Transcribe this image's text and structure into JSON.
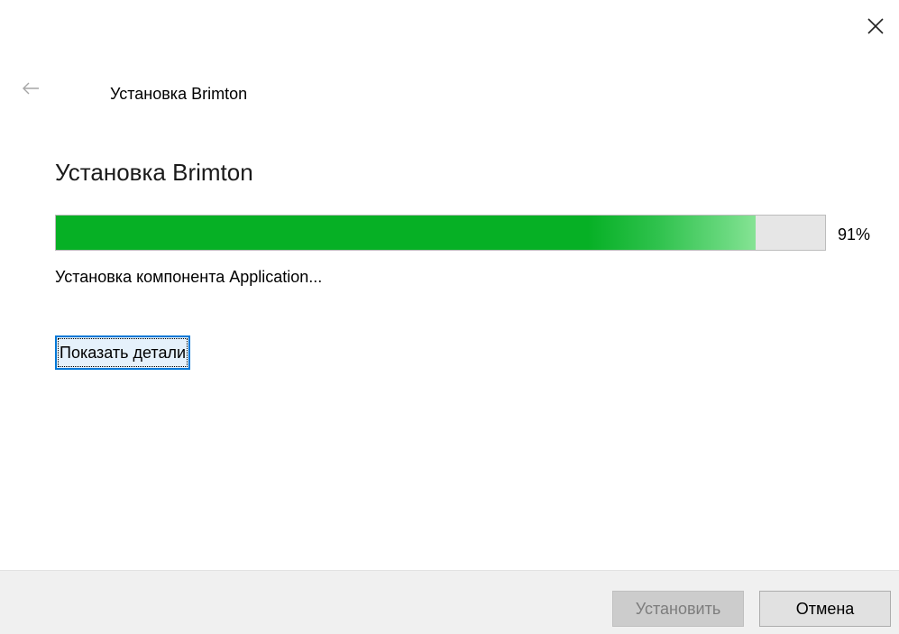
{
  "window": {
    "title": "Установка Brimton",
    "close_icon": "close-icon",
    "back_icon": "back-arrow-icon"
  },
  "main": {
    "heading": "Установка Brimton",
    "progress": {
      "value_percent": 91,
      "label": "91%",
      "fill_color": "#06b025"
    },
    "status_text": "Установка компонента Application...",
    "details_button_label": "Показать детали"
  },
  "footer": {
    "install_label": "Установить",
    "install_enabled": false,
    "cancel_label": "Отмена"
  },
  "colors": {
    "accent_focus": "#0078d7",
    "progress_green": "#06b025",
    "footer_background": "#f0f0f0"
  }
}
